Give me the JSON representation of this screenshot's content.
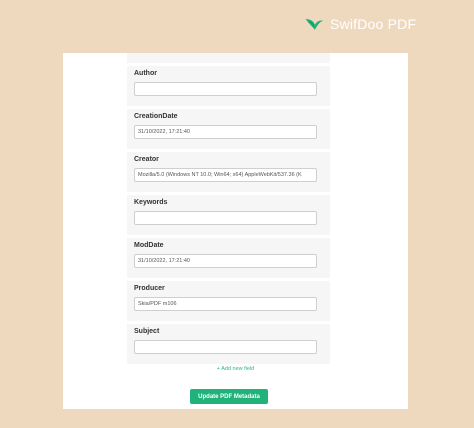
{
  "brand": {
    "name": "SwifDoo PDF",
    "logo_icon": "bird-logo-icon"
  },
  "colors": {
    "background": "#eed9bf",
    "accent": "#1fb27a"
  },
  "fields": [
    {
      "label": "Author",
      "value": ""
    },
    {
      "label": "CreationDate",
      "value": "31/10/2022, 17:21:40"
    },
    {
      "label": "Creator",
      "value": "Mozilla/5.0 (Windows NT 10.0; Win64; x64) AppleWebKit/537.36 (K"
    },
    {
      "label": "Keywords",
      "value": ""
    },
    {
      "label": "ModDate",
      "value": "31/10/2022, 17:21:40"
    },
    {
      "label": "Producer",
      "value": "Skia/PDF m106"
    },
    {
      "label": "Subject",
      "value": ""
    }
  ],
  "actions": {
    "add_field_label": "+ Add new field",
    "update_label": "Update PDF Metadata"
  }
}
